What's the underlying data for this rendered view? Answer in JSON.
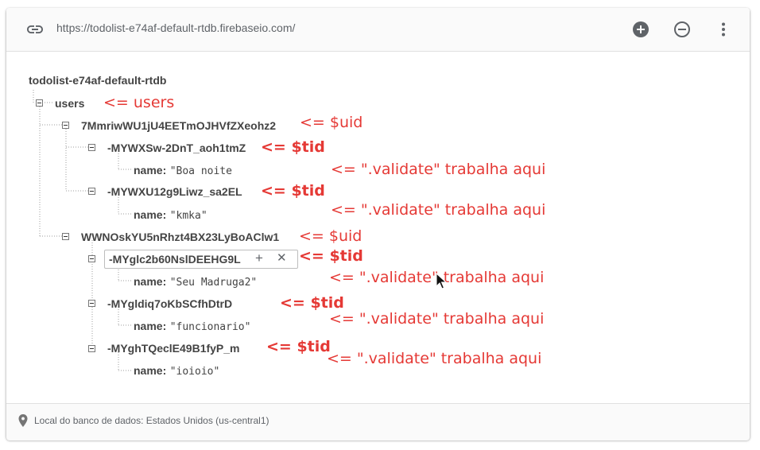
{
  "header": {
    "url": "https://todolist-e74af-default-rtdb.firebaseio.com/",
    "add_icon": "plus-circle-icon",
    "remove_icon": "minus-circle-icon",
    "menu_icon": "more-vert-icon"
  },
  "tree": {
    "root": "todolist-e74af-default-rtdb",
    "users_key": "users",
    "user1": {
      "key": "7MmriwWU1jU4EETmOJHVfZXeohz2",
      "tasks": [
        {
          "key": "-MYWXSw-2DnT_aoh1tmZ",
          "field": "name:",
          "value": "\"Boa noite"
        },
        {
          "key": "-MYWXU12g9Liwz_sa2EL",
          "field": "name:",
          "value": "\"kmka\""
        }
      ]
    },
    "user2": {
      "key": "WWNOskYU5nRhzt4BX23LyBoAClw1",
      "tasks": [
        {
          "key": "-MYglc2b60NslDEEHG9L",
          "field": "name:",
          "value": "\"Seu Madruga2\""
        },
        {
          "key": "-MYgldiq7oKbSCfhDtrD",
          "field": "name:",
          "value": "\"funcionario\""
        },
        {
          "key": "-MYghTQeclE49B1fyP_m",
          "field": "name:",
          "value": "\"ioioio\""
        }
      ]
    }
  },
  "edit_box": {
    "plus": "+",
    "close": "✕"
  },
  "annotations": {
    "users": "<= users",
    "uid": "<= $uid",
    "tid": "<= $tid",
    "validate": "<= \".validate\" trabalha aqui"
  },
  "footer": {
    "location": "Local do banco de dados: Estados Unidos (us-central1)",
    "pin_icon": "location-pin-icon"
  },
  "colors": {
    "annotation": "#e53935",
    "text": "#444444",
    "muted": "#5f6368"
  }
}
